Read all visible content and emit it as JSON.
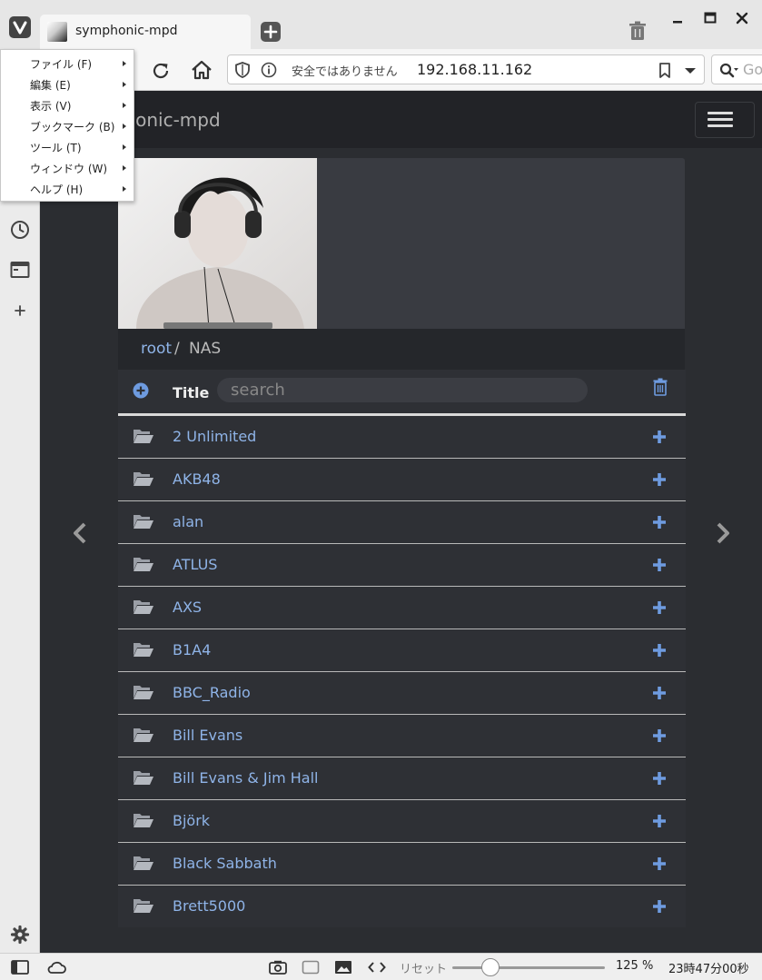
{
  "browser": {
    "tab": {
      "title": "symphonic-mpd"
    },
    "address": {
      "security_text": "安全ではありません",
      "url": "192.168.11.162",
      "search_placeholder": "Go"
    },
    "menu": [
      {
        "label": "ファイル (F)"
      },
      {
        "label": "編集 (E)"
      },
      {
        "label": "表示 (V)"
      },
      {
        "label": "ブックマーク (B)"
      },
      {
        "label": "ツール (T)"
      },
      {
        "label": "ウィンドウ (W)"
      },
      {
        "label": "ヘルプ (H)"
      }
    ],
    "status": {
      "reset_label": "リセット",
      "zoom": "125 %",
      "zoom_level": 0.25,
      "clock": "23時47分00秒"
    }
  },
  "app": {
    "brand": "symphonic-mpd",
    "breadcrumb": {
      "root": "root",
      "separator": "/",
      "current": "NAS"
    },
    "list": {
      "header_title": "Title",
      "search_placeholder": "search",
      "items": [
        {
          "label": "2 Unlimited"
        },
        {
          "label": "AKB48"
        },
        {
          "label": "alan"
        },
        {
          "label": "ATLUS"
        },
        {
          "label": "AXS"
        },
        {
          "label": "B1A4"
        },
        {
          "label": "BBC_Radio"
        },
        {
          "label": "Bill Evans"
        },
        {
          "label": "Bill Evans & Jim Hall"
        },
        {
          "label": "Björk"
        },
        {
          "label": "Black Sabbath"
        },
        {
          "label": "Brett5000"
        }
      ]
    }
  },
  "colors": {
    "link": "#8fb4e8",
    "accent_icon": "#6e9be0",
    "row_bg": "#2e3035",
    "navbar_bg": "#222327"
  }
}
